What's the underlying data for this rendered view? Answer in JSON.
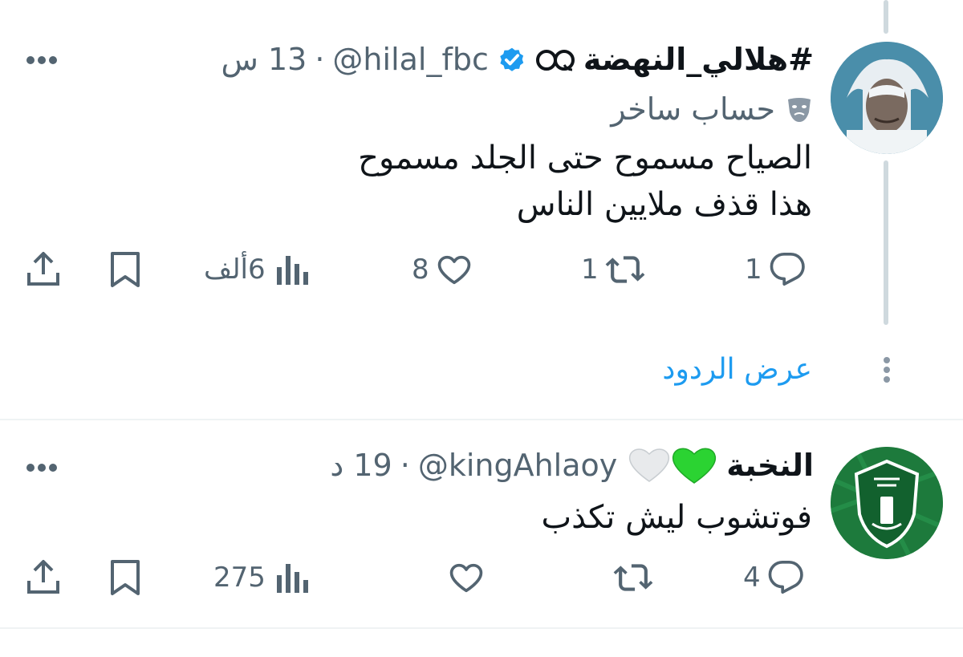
{
  "tweet1": {
    "name": "#هلالي_النهضة",
    "emoji_icon": "ghost-glasses-icon",
    "verified_icon": "verified-badge-icon",
    "handle": "@hilal_fbc",
    "separator": "·",
    "time": "13 س",
    "label_icon": "theater-masks-icon",
    "label": "حساب ساخر",
    "lines": [
      "الصياح مسموح حتى الجلد مسموح",
      "هذا قذف ملايين الناس"
    ],
    "actions": {
      "replies": "1",
      "retweets": "1",
      "likes": "8",
      "views": "6ألف"
    }
  },
  "show_replies": "عرض الردود",
  "tweet2": {
    "name": "النخبة",
    "emojis": "💚🤍",
    "handle": "@kingAhlaoy",
    "separator": "·",
    "time": "19 د",
    "lines": [
      "فوتشوب ليش تكذب"
    ],
    "actions": {
      "replies": "4",
      "retweets": "",
      "likes": "",
      "views": "275"
    }
  },
  "colors": {
    "text": "#0f1419",
    "secondary": "#536471",
    "accent": "#1d9bf0",
    "thread": "#cfd9de",
    "green": "#2bd332"
  }
}
